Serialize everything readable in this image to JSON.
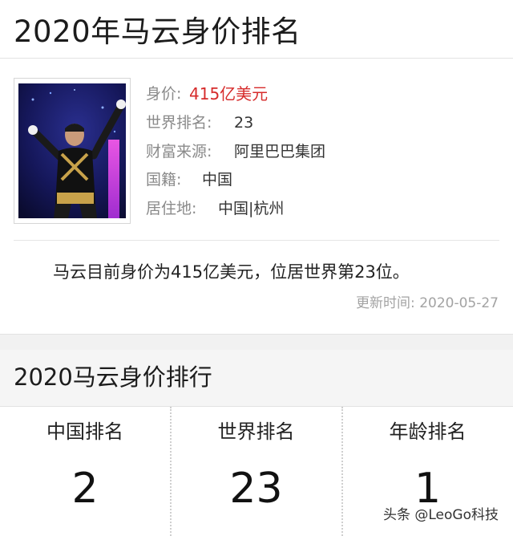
{
  "page": {
    "title": "2020年马云身价排名"
  },
  "profile": {
    "net_worth_label": "身价:",
    "net_worth_value": "415亿美元",
    "world_rank_label": "世界排名:",
    "world_rank_value": "23",
    "wealth_source_label": "财富来源:",
    "wealth_source_value": "阿里巴巴集团",
    "nationality_label": "国籍:",
    "nationality_value": "中国",
    "residence_label": "居住地:",
    "residence_value": "中国|杭州"
  },
  "summary": {
    "text": "马云目前身价为415亿美元，位居世界第23位。",
    "updated_label": "更新时间:",
    "updated_value": "2020-05-27"
  },
  "ranking_section": {
    "title": "2020马云身价排行",
    "columns": [
      {
        "label": "中国排名",
        "value": "2"
      },
      {
        "label": "世界排名",
        "value": "23"
      },
      {
        "label": "年龄排名",
        "value": "1"
      }
    ]
  },
  "watermark": {
    "text": "头条 @LeoGo科技"
  },
  "colors": {
    "accent_red": "#d62b2b",
    "label_gray": "#8a8a8a",
    "section_bg": "#f5f5f5"
  }
}
